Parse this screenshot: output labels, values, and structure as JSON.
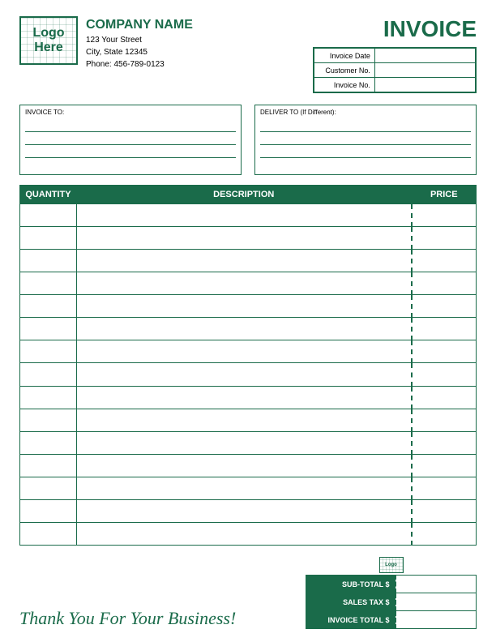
{
  "header": {
    "company_name": "COMPANY NAME",
    "address_line1": "123 Your Street",
    "address_line2": "City, State 12345",
    "phone": "Phone: 456-789-0123",
    "logo_line1": "Logo",
    "logo_line2": "Here",
    "invoice_title": "INVOICE"
  },
  "invoice_fields": {
    "labels": [
      "Invoice Date",
      "Customer No.",
      "Invoice No."
    ],
    "values": [
      "",
      "",
      ""
    ]
  },
  "address_section": {
    "invoice_to_label": "INVOICE TO:",
    "deliver_to_label": "DELIVER TO (If Different):"
  },
  "table": {
    "col_quantity": "QUANTITY",
    "col_description": "DESCRIPTION",
    "col_price": "PRICE",
    "rows": [
      {
        "qty": "",
        "desc": "",
        "price": ""
      },
      {
        "qty": "",
        "desc": "",
        "price": ""
      },
      {
        "qty": "",
        "desc": "",
        "price": ""
      },
      {
        "qty": "",
        "desc": "",
        "price": ""
      },
      {
        "qty": "",
        "desc": "",
        "price": ""
      },
      {
        "qty": "",
        "desc": "",
        "price": ""
      },
      {
        "qty": "",
        "desc": "",
        "price": ""
      },
      {
        "qty": "",
        "desc": "",
        "price": ""
      },
      {
        "qty": "",
        "desc": "",
        "price": ""
      },
      {
        "qty": "",
        "desc": "",
        "price": ""
      },
      {
        "qty": "",
        "desc": "",
        "price": ""
      },
      {
        "qty": "",
        "desc": "",
        "price": ""
      },
      {
        "qty": "",
        "desc": "",
        "price": ""
      },
      {
        "qty": "",
        "desc": "",
        "price": ""
      },
      {
        "qty": "",
        "desc": "",
        "price": ""
      }
    ]
  },
  "totals": {
    "sub_total_label": "SUB-TOTAL $",
    "sales_tax_label": "SALES TAX $",
    "invoice_total_label": "INVOICE TOTAL $",
    "sub_total_value": "",
    "sales_tax_value": "",
    "invoice_total_value": ""
  },
  "footer": {
    "thank_you_text": "Thank You For Your Business!"
  },
  "colors": {
    "primary": "#1a6b4a"
  }
}
